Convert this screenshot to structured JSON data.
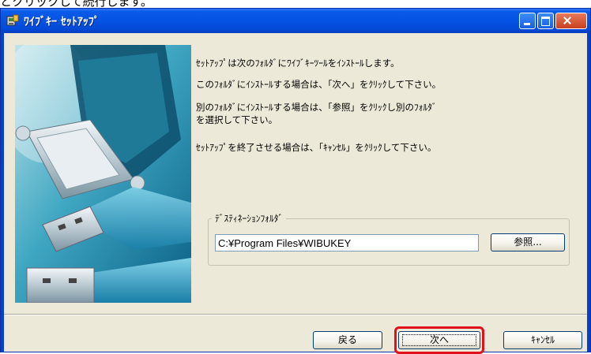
{
  "page_caption": "とクリックして続行します。",
  "window": {
    "title": "ﾜｲﾌﾞｷｰ ｾｯﾄｱｯﾌﾟ",
    "icon": "setup-icon",
    "controls": [
      "minimize-icon",
      "maximize-icon",
      "close-icon"
    ]
  },
  "messages": [
    "ｾｯﾄｱｯﾌﾟは次のﾌｫﾙﾀﾞにﾜｲﾌﾞｷｰﾂｰﾙをｲﾝｽﾄｰﾙします。",
    "このﾌｫﾙﾀﾞにｲﾝｽﾄｰﾙする場合は、「次へ」をｸﾘｯｸして下さい。",
    "別のﾌｫﾙﾀﾞにｲﾝｽﾄｰﾙする場合は、「参照」をｸﾘｯｸし別のﾌｫﾙﾀﾞ\nを選択して下さい。",
    "ｾｯﾄｱｯﾌﾟを終了させる場合は、「ｷｬﾝｾﾙ」をｸﾘｯｸして下さい。"
  ],
  "destination": {
    "label": "ﾃﾞｽﾃｨﾈｰｼｮﾝﾌｫﾙﾀﾞ",
    "path": "C:¥Program Files¥WIBUKEY",
    "browse_label": "参照..."
  },
  "buttons": {
    "back": "戻る",
    "next": "次へ",
    "cancel": "ｷｬﾝｾﾙ"
  },
  "colors": {
    "titlebar": "#0653e3",
    "dialog_bg": "#ece9d8",
    "highlight": "#e0101c"
  }
}
